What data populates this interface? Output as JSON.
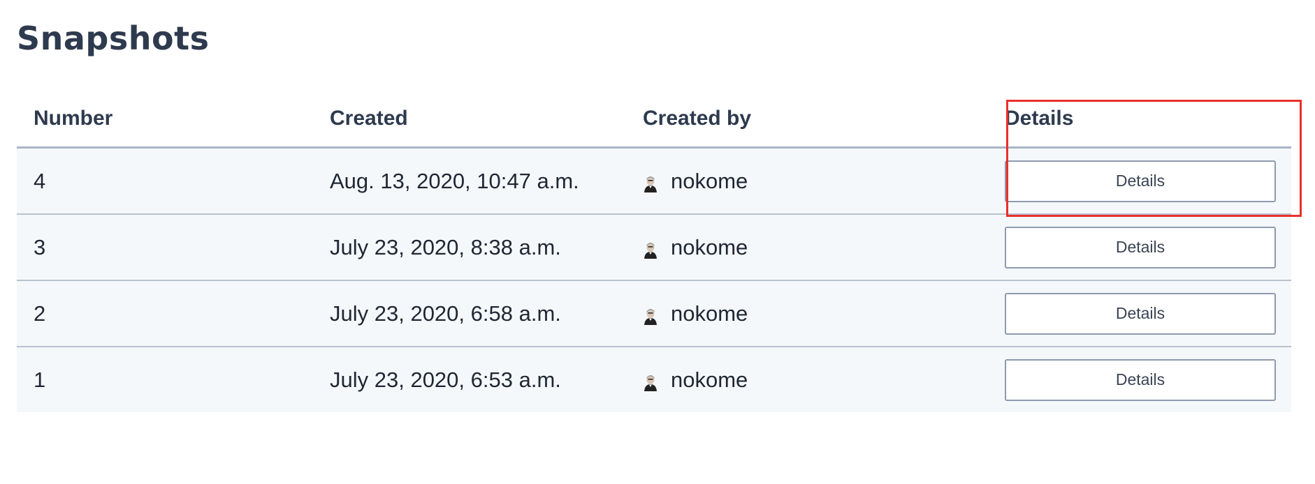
{
  "page": {
    "title": "Snapshots"
  },
  "table": {
    "headers": {
      "number": "Number",
      "created": "Created",
      "created_by": "Created by",
      "details": "Details"
    },
    "rows": [
      {
        "number": "4",
        "created": "Aug. 13, 2020, 10:47 a.m.",
        "created_by": "nokome",
        "details_label": "Details"
      },
      {
        "number": "3",
        "created": "July 23, 2020, 8:38 a.m.",
        "created_by": "nokome",
        "details_label": "Details"
      },
      {
        "number": "2",
        "created": "July 23, 2020, 6:58 a.m.",
        "created_by": "nokome",
        "details_label": "Details"
      },
      {
        "number": "1",
        "created": "July 23, 2020, 6:53 a.m.",
        "created_by": "nokome",
        "details_label": "Details"
      }
    ]
  },
  "icons": {
    "avatar": "user-avatar-icon"
  },
  "colors": {
    "title": "#2e3a4e",
    "row_background": "#f5f8fb",
    "highlight": "#e8302a"
  }
}
